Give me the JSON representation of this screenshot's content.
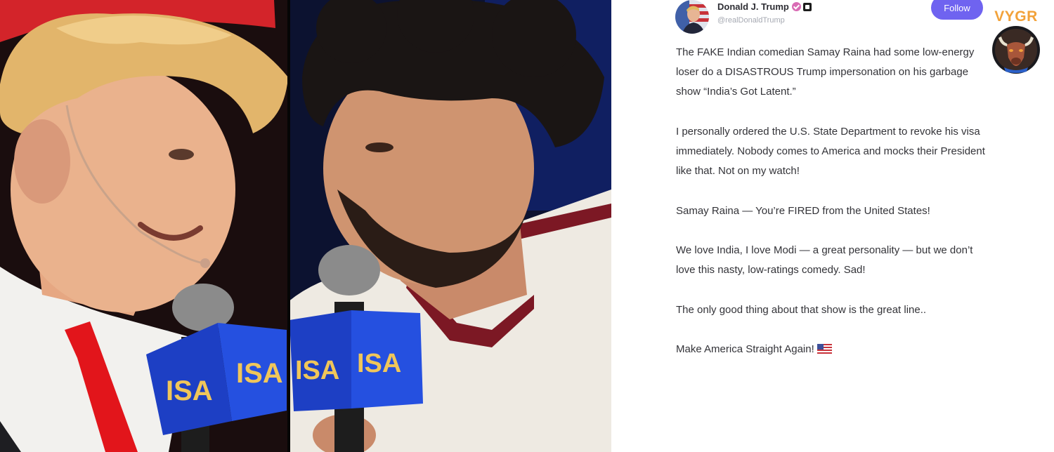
{
  "post": {
    "display_name": "Donald J. Trump",
    "handle": "@realDonaldTrump",
    "follow_label": "Follow",
    "paragraphs": [
      "The FAKE Indian comedian Samay Raina had some low-energy loser do a DISASTROUS Trump impersonation on his garbage show “India’s Got Latent.”",
      "I personally ordered the U.S. State Department to revoke his visa immediately. Nobody comes to America and mocks their President like that. Not on my watch!",
      "Samay Raina — You’re FIRED from the United States!",
      "We love India, I love Modi — a great personality — but we don’t love this nasty, low-ratings comedy. Sad!",
      "The only good thing about that show is the great line..",
      "Make America Straight Again!"
    ],
    "closing_emoji": "us-flag-icon"
  },
  "watermark": {
    "text": "VYGR",
    "emblem": "bull-head-icon"
  },
  "colors": {
    "follow_button": "#6f63f0",
    "verified_badge": "#d96bb4",
    "watermark_text": "#f2a23a",
    "mic_flag": "#1d3fc4",
    "tie": "#e2151b"
  }
}
